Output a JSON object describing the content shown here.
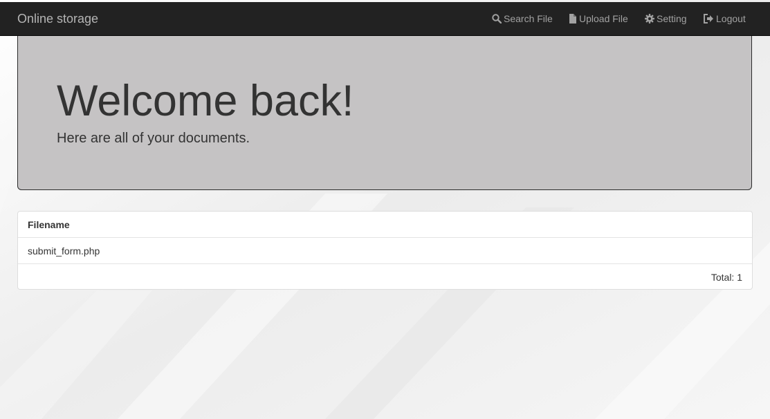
{
  "app": {
    "brand": "Online storage"
  },
  "nav": {
    "items": [
      {
        "label": "Search File",
        "icon": "search-icon"
      },
      {
        "label": "Upload File",
        "icon": "file-icon"
      },
      {
        "label": "Setting",
        "icon": "gear-icon"
      },
      {
        "label": "Logout",
        "icon": "logout-icon"
      }
    ]
  },
  "hero": {
    "title": "Welcome back!",
    "subtitle": "Here are all of your documents."
  },
  "files": {
    "header": "Filename",
    "rows": [
      "submit_form.php"
    ],
    "total_label": "Total: 1"
  },
  "colors": {
    "navbar": "#222222",
    "nav_text": "#a2a2a2",
    "hero_bg": "#c5c3c4",
    "text": "#333333"
  }
}
